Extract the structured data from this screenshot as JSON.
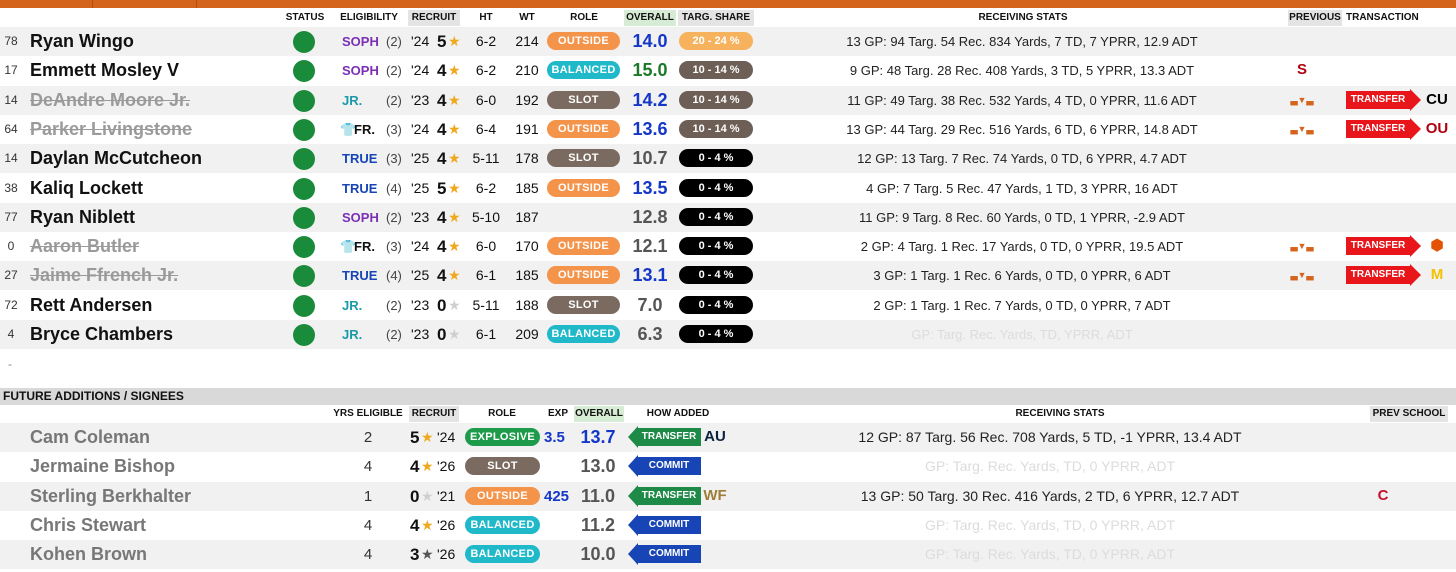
{
  "colors": {
    "accent": "#d4641c",
    "status_green": "#1a8b3a",
    "outside": "#f4934a",
    "balanced": "#1fb9c9",
    "slot": "#7a6a60",
    "explosive": "#1e9b4a",
    "transfer_red": "#e8161b"
  },
  "headers": {
    "status": "STATUS",
    "eligibility": "ELIGIBILITY",
    "recruit": "RECRUIT",
    "ht": "HT",
    "wt": "WT",
    "role": "ROLE",
    "overall": "OVERALL",
    "targ_share": "TARG. SHARE",
    "receiving_stats": "RECEIVING STATS",
    "previous": "PREVIOUS",
    "transaction": "TRANSACTION"
  },
  "roster": [
    {
      "num": "78",
      "name": "Ryan Wingo",
      "out": false,
      "elig": "SOPH",
      "elig_color": "#7b2fb5",
      "yrs": "(2)",
      "rec_year": "'24",
      "rec_stars": "5",
      "star_color": "#f0a91e",
      "ht": "6-2",
      "wt": "214",
      "role": "OUTSIDE",
      "role_cls": "p-outside",
      "overall": "14.0",
      "ovr_color": "#1437c8",
      "share": "20 - 24 %",
      "share_cls": "s-orange",
      "stats": "13 GP: 94 Targ. 54 Rec. 834 Yards, 7 TD, 7 YPRR, 12.9 ADT",
      "prev": "",
      "trans": "",
      "dest": ""
    },
    {
      "num": "17",
      "name": "Emmett Mosley V",
      "out": false,
      "elig": "SOPH",
      "elig_color": "#7b2fb5",
      "yrs": "(2)",
      "rec_year": "'24",
      "rec_stars": "4",
      "star_color": "#f0a91e",
      "ht": "6-2",
      "wt": "210",
      "role": "BALANCED",
      "role_cls": "p-balanced",
      "overall": "15.0",
      "ovr_color": "#1a7a2a",
      "share": "10 - 14 %",
      "share_cls": "s-brown",
      "stats": "9 GP: 48 Targ. 28 Rec. 408 Yards, 3 TD, 5 YPRR, 13.3 ADT",
      "prev": "S",
      "trans": "",
      "dest": ""
    },
    {
      "num": "14",
      "name": "DeAndre Moore Jr.",
      "out": true,
      "elig": "JR.",
      "elig_color": "#1a9aa8",
      "yrs": "(2)",
      "rec_year": "'23",
      "rec_stars": "4",
      "star_color": "#f0a91e",
      "ht": "6-0",
      "wt": "192",
      "role": "SLOT",
      "role_cls": "p-slot",
      "overall": "14.2",
      "ovr_color": "#1437c8",
      "share": "10 - 14 %",
      "share_cls": "s-brown",
      "stats": "11 GP: 49 Targ. 38 Rec. 532 Yards, 4 TD, 0 YPRR, 11.6 ADT",
      "prev": "longhorn",
      "trans": "TRANSFER",
      "dest": "CU"
    },
    {
      "num": "64",
      "name": "Parker Livingstone",
      "out": true,
      "elig": "FR.",
      "elig_color": "#111",
      "redshirt": true,
      "yrs": "(3)",
      "rec_year": "'24",
      "rec_stars": "4",
      "star_color": "#f0a91e",
      "ht": "6-4",
      "wt": "191",
      "role": "OUTSIDE",
      "role_cls": "p-outside",
      "overall": "13.6",
      "ovr_color": "#1437c8",
      "share": "10 - 14 %",
      "share_cls": "s-brown",
      "stats": "13 GP: 44 Targ. 29 Rec. 516 Yards, 6 TD, 6 YPRR, 14.8 ADT",
      "prev": "longhorn",
      "trans": "TRANSFER",
      "dest": "OU"
    },
    {
      "num": "14",
      "name": "Daylan McCutcheon",
      "out": false,
      "elig": "TRUE",
      "elig_color": "#1745b5",
      "yrs": "(3)",
      "rec_year": "'25",
      "rec_stars": "4",
      "star_color": "#f0a91e",
      "ht": "5-11",
      "wt": "178",
      "role": "SLOT",
      "role_cls": "p-slot",
      "overall": "10.7",
      "ovr_color": "#555",
      "share": "0 - 4 %",
      "share_cls": "s-black",
      "stats": "12 GP: 13 Targ. 7 Rec. 74 Yards, 0 TD, 6 YPRR, 4.7 ADT",
      "prev": "",
      "trans": "",
      "dest": ""
    },
    {
      "num": "38",
      "name": "Kaliq Lockett",
      "out": false,
      "elig": "TRUE",
      "elig_color": "#1745b5",
      "yrs": "(4)",
      "rec_year": "'25",
      "rec_stars": "5",
      "star_color": "#f0a91e",
      "ht": "6-2",
      "wt": "185",
      "role": "OUTSIDE",
      "role_cls": "p-outside",
      "overall": "13.5",
      "ovr_color": "#1437c8",
      "share": "0 - 4 %",
      "share_cls": "s-black",
      "stats": "4 GP: 7 Targ. 5 Rec. 47 Yards, 1 TD, 3 YPRR, 16 ADT",
      "prev": "",
      "trans": "",
      "dest": ""
    },
    {
      "num": "77",
      "name": "Ryan Niblett",
      "out": false,
      "elig": "SOPH",
      "elig_color": "#7b2fb5",
      "yrs": "(2)",
      "rec_year": "'23",
      "rec_stars": "4",
      "star_color": "#f0a91e",
      "ht": "5-10",
      "wt": "187",
      "role": "",
      "role_cls": "",
      "overall": "12.8",
      "ovr_color": "#555",
      "share": "0 - 4 %",
      "share_cls": "s-black",
      "stats": "11 GP: 9 Targ. 8 Rec. 60 Yards, 0 TD, 1 YPRR, -2.9 ADT",
      "prev": "",
      "trans": "",
      "dest": ""
    },
    {
      "num": "0",
      "name": "Aaron Butler",
      "out": true,
      "elig": "FR.",
      "elig_color": "#111",
      "redshirt": true,
      "yrs": "(3)",
      "rec_year": "'24",
      "rec_stars": "4",
      "star_color": "#f0a91e",
      "ht": "6-0",
      "wt": "170",
      "role": "OUTSIDE",
      "role_cls": "p-outside",
      "overall": "12.1",
      "ovr_color": "#555",
      "share": "0 - 4 %",
      "share_cls": "s-black",
      "stats": "2 GP: 4 Targ. 1 Rec. 17 Yards, 0 TD, 0 YPRR, 19.5 ADT",
      "prev": "longhorn",
      "trans": "TRANSFER",
      "dest": "OSU"
    },
    {
      "num": "27",
      "name": "Jaime Ffrench Jr.",
      "out": true,
      "elig": "TRUE",
      "elig_color": "#1745b5",
      "yrs": "(4)",
      "rec_year": "'25",
      "rec_stars": "4",
      "star_color": "#f0a91e",
      "ht": "6-1",
      "wt": "185",
      "role": "OUTSIDE",
      "role_cls": "p-outside",
      "overall": "13.1",
      "ovr_color": "#1437c8",
      "share": "0 - 4 %",
      "share_cls": "s-black",
      "stats": "3 GP: 1 Targ. 1 Rec. 6 Yards, 0 TD, 0 YPRR, 6 ADT",
      "prev": "longhorn",
      "trans": "TRANSFER",
      "dest": "M"
    },
    {
      "num": "72",
      "name": "Rett Andersen",
      "out": false,
      "elig": "JR.",
      "elig_color": "#1a9aa8",
      "yrs": "(2)",
      "rec_year": "'23",
      "rec_stars": "0",
      "star_color": "#cfcfcf",
      "ht": "5-11",
      "wt": "188",
      "role": "SLOT",
      "role_cls": "p-slot",
      "overall": "7.0",
      "ovr_color": "#555",
      "share": "0 - 4 %",
      "share_cls": "s-black",
      "stats": "2 GP: 1 Targ. 1 Rec. 7 Yards, 0 TD, 0 YPRR, 7 ADT",
      "prev": "",
      "trans": "",
      "dest": ""
    },
    {
      "num": "4",
      "name": "Bryce Chambers",
      "out": false,
      "elig": "JR.",
      "elig_color": "#1a9aa8",
      "yrs": "(2)",
      "rec_year": "'23",
      "rec_stars": "0",
      "star_color": "#cfcfcf",
      "ht": "6-1",
      "wt": "209",
      "role": "BALANCED",
      "role_cls": "p-balanced",
      "overall": "6.3",
      "ovr_color": "#555",
      "share": "0 - 4 %",
      "share_cls": "s-black",
      "stats": "GP: Targ. Rec. Yards, TD, YPRR, ADT",
      "ghost": true,
      "prev": "",
      "trans": "",
      "dest": ""
    }
  ],
  "dash": "-",
  "future": {
    "section_title": "FUTURE ADDITIONS / SIGNEES",
    "headers": {
      "yrs_eligible": "YRS ELIGIBLE",
      "recruit": "RECRUIT",
      "role": "ROLE",
      "exp": "EXP",
      "overall": "OVERALL",
      "how_added": "HOW ADDED",
      "receiving_stats": "RECEIVING STATS",
      "prev_school": "PREV SCHOOL"
    },
    "rows": [
      {
        "name": "Cam Coleman",
        "yrs": "2",
        "stars": "5",
        "star_color": "#f0a91e",
        "year": "'24",
        "role": "EXPLOSIVE",
        "role_cls": "p-explosive",
        "exp": "3.5",
        "overall": "13.7",
        "ovr_color": "#1437c8",
        "how": "TRANSFER",
        "how_cls": "h-transfer",
        "from": "AU",
        "stats": "12 GP: 87 Targ. 56 Rec. 708 Yards, 5 TD, -1 YPRR, 13.4 ADT",
        "ghost": false,
        "prev": ""
      },
      {
        "name": "Jermaine Bishop",
        "yrs": "4",
        "stars": "4",
        "star_color": "#f0a91e",
        "year": "'26",
        "role": "SLOT",
        "role_cls": "p-slot",
        "exp": "",
        "overall": "13.0",
        "ovr_color": "#555",
        "how": "COMMIT",
        "how_cls": "h-commit",
        "from": "",
        "stats": "GP: Targ. Rec. Yards, TD, 0 YPRR, ADT",
        "ghost": true,
        "prev": ""
      },
      {
        "name": "Sterling Berkhalter",
        "yrs": "1",
        "stars": "0",
        "star_color": "#cfcfcf",
        "year": "'21",
        "role": "OUTSIDE",
        "role_cls": "p-outside",
        "exp": "425",
        "overall": "11.0",
        "ovr_color": "#555",
        "how": "TRANSFER",
        "how_cls": "h-transfer",
        "from": "WF",
        "stats": "13 GP: 50 Targ. 30 Rec. 416 Yards, 2 TD, 6 YPRR, 12.7 ADT",
        "ghost": false,
        "prev": "C"
      },
      {
        "name": "Chris Stewart",
        "yrs": "4",
        "stars": "4",
        "star_color": "#f0a91e",
        "year": "'26",
        "role": "BALANCED",
        "role_cls": "p-balanced",
        "exp": "",
        "overall": "11.2",
        "ovr_color": "#555",
        "how": "COMMIT",
        "how_cls": "h-commit",
        "from": "",
        "stats": "GP: Targ. Rec. Yards, TD, 0 YPRR, ADT",
        "ghost": true,
        "prev": ""
      },
      {
        "name": "Kohen Brown",
        "yrs": "4",
        "stars": "3",
        "star_color": "#555",
        "year": "'26",
        "role": "BALANCED",
        "role_cls": "p-balanced",
        "exp": "",
        "overall": "10.0",
        "ovr_color": "#555",
        "how": "COMMIT",
        "how_cls": "h-commit",
        "from": "",
        "stats": "GP: Targ. Rec. Yards, TD, 0 YPRR, ADT",
        "ghost": true,
        "prev": ""
      }
    ]
  }
}
